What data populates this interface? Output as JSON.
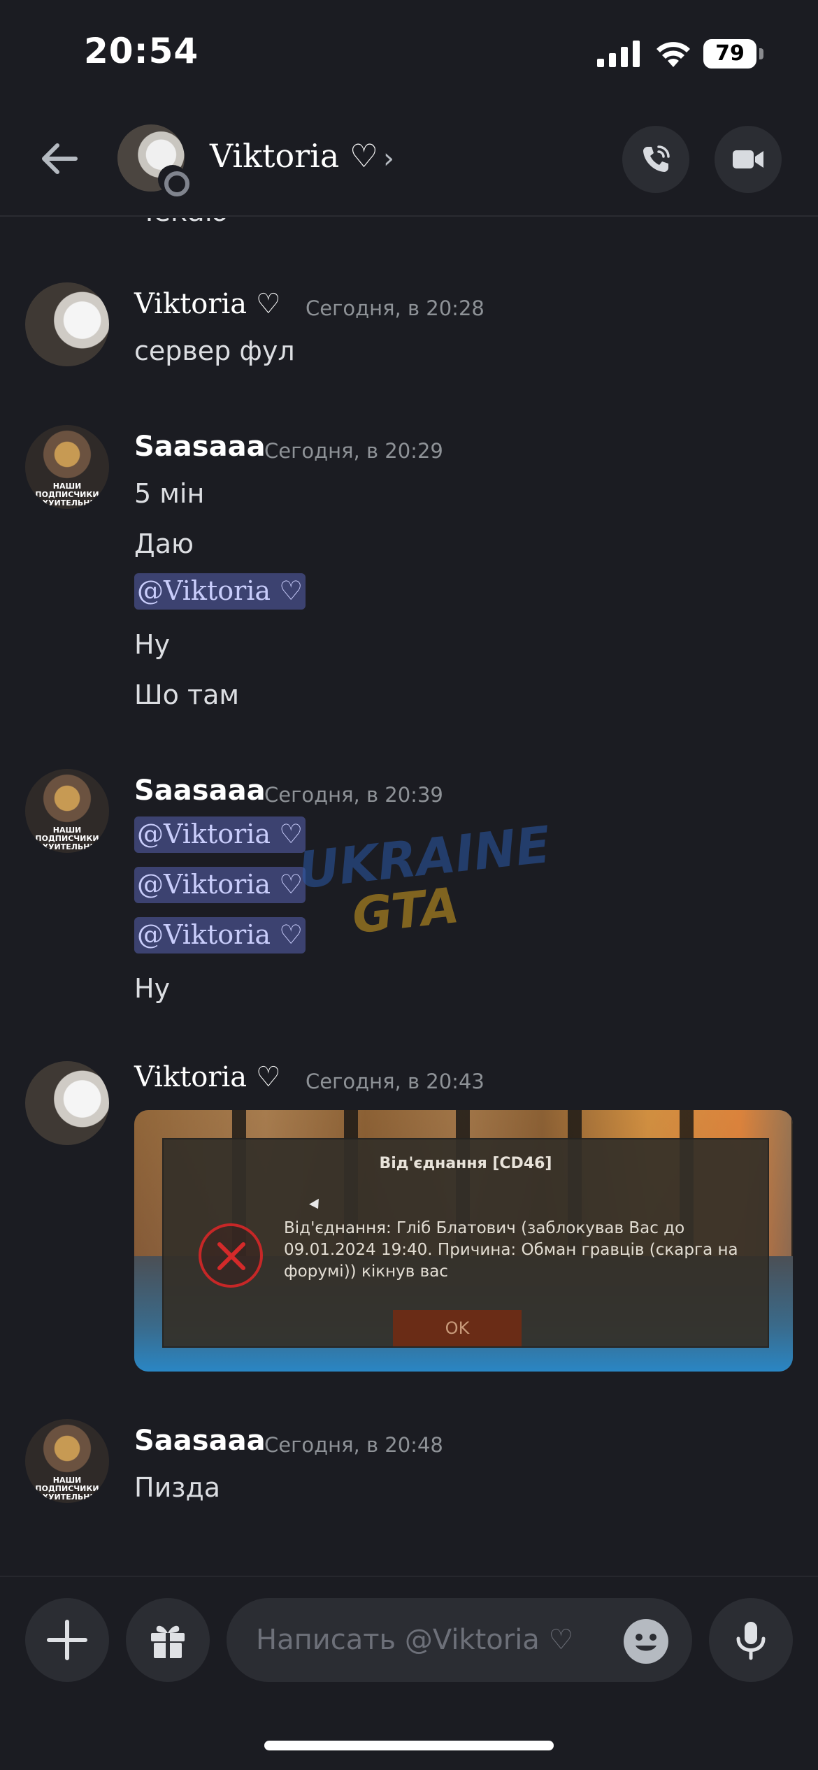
{
  "status_bar": {
    "time": "20:54",
    "battery": "79",
    "icons": [
      "signal-icon",
      "wifi-icon",
      "battery-icon"
    ]
  },
  "header": {
    "title": "Viktoria ♡",
    "chevron": "›",
    "icons": [
      "back-arrow-icon",
      "phone-call-icon",
      "video-camera-icon"
    ]
  },
  "messages": {
    "partial_previous": "Чекаю",
    "groups": [
      {
        "author": "Viktoria ♡",
        "time": "Сегодня, в 20:28",
        "lines": [
          "сервер фул"
        ]
      },
      {
        "author": "Saasaaa",
        "time": "Сегодня, в 20:29",
        "avatar_caption": "НАШИ ПОДПИСЧИКИ АХУИТЕЛЬНЫ",
        "lines": [
          "5 мін",
          "Даю",
          "@Viktoria ♡",
          "Ну",
          "Шо там"
        ]
      },
      {
        "author": "Saasaaa",
        "time": "Сегодня, в 20:39",
        "avatar_caption": "НАШИ ПОДПИСЧИКИ АХУИТЕЛЬНЫ",
        "lines": [
          "@Viktoria ♡",
          "@Viktoria ♡",
          "@Viktoria ♡",
          "Ну"
        ]
      },
      {
        "author": "Viktoria ♡",
        "time": "Сегодня, в 20:43",
        "attachment": {
          "dialog_title": "Від'єднання [CD46]",
          "dialog_text": "Від'єднання: Гліб Блатович (заблокував Вас до 09.01.2024 19:40. Причина: Обман гравців (скарга на форумі)) кікнув вас",
          "ok_label": "OK",
          "icon": "error-x-icon"
        }
      },
      {
        "author": "Saasaaa",
        "time": "Сегодня, в 20:48",
        "avatar_caption": "НАШИ ПОДПИСЧИКИ АХУИТЕЛЬНЫ",
        "lines": [
          "Пизда"
        ]
      }
    ]
  },
  "watermark": {
    "line1": "UKRAINE",
    "line2": "GTA"
  },
  "composer": {
    "placeholder": "Написать @Viktoria ♡",
    "icons": [
      "plus-icon",
      "gift-icon",
      "emoji-icon",
      "microphone-icon"
    ]
  },
  "colors": {
    "background": "#1b1c22",
    "mention_bg": "#3c4270",
    "mention_text": "#c9cdfb",
    "timestamp": "#8e9297"
  }
}
